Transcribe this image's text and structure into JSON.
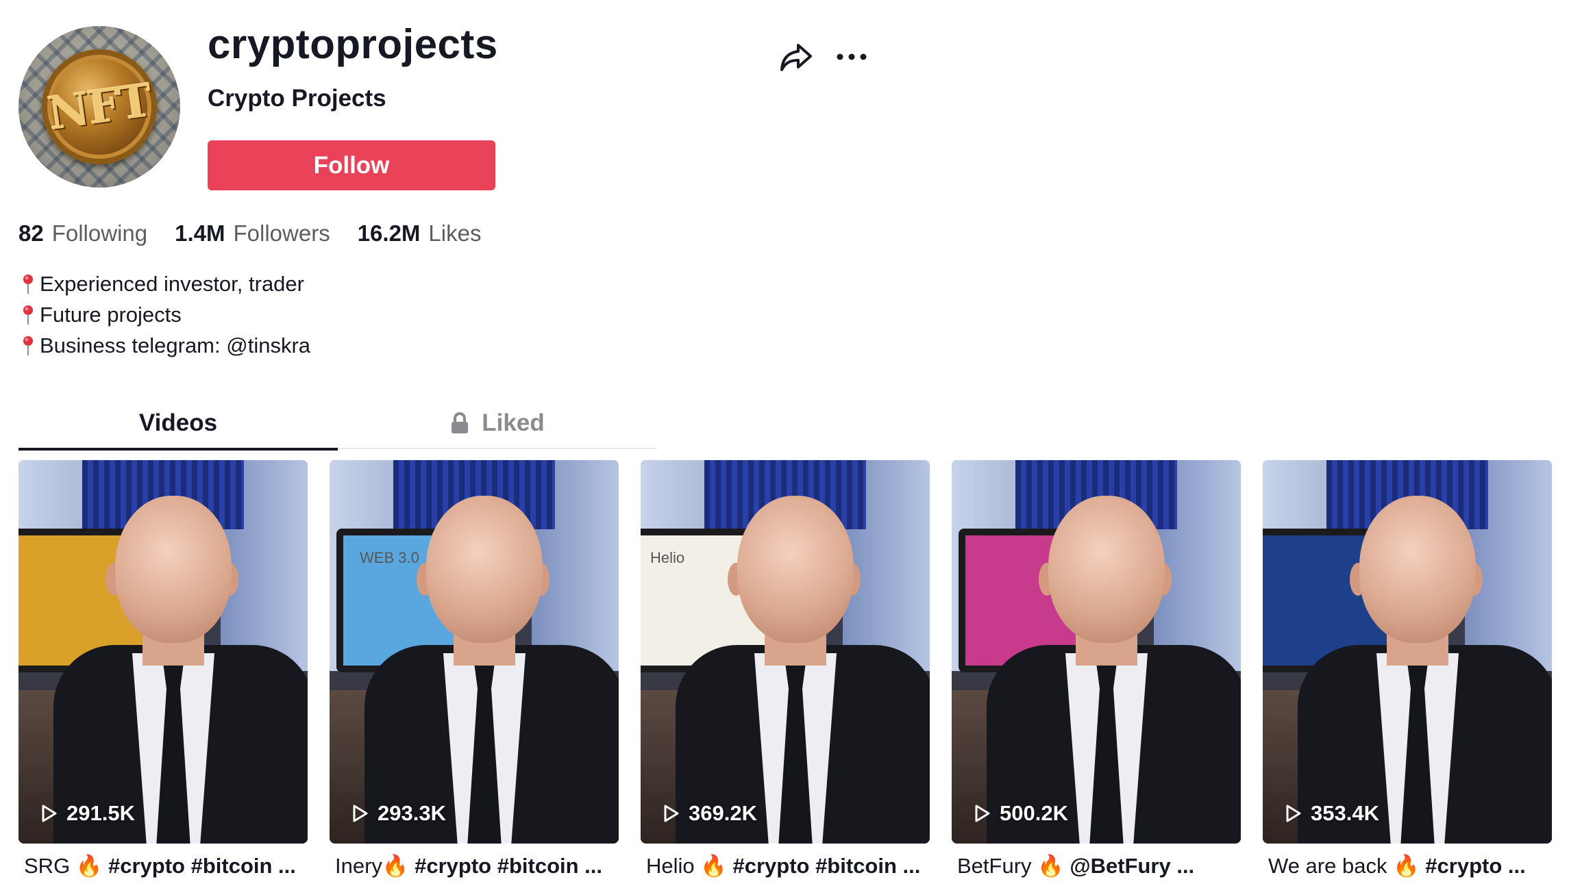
{
  "profile": {
    "avatar_text": "NFT",
    "username": "cryptoprojects",
    "nickname": "Crypto Projects",
    "follow_label": "Follow",
    "share_icon": "share-icon",
    "more_icon": "more-icon"
  },
  "stats": [
    {
      "value": "82",
      "label": "Following"
    },
    {
      "value": "1.4M",
      "label": "Followers"
    },
    {
      "value": "16.2M",
      "label": "Likes"
    }
  ],
  "bio": [
    "Experienced investor, trader",
    "Future projects",
    "Business telegram: @tinskra"
  ],
  "tabs": [
    {
      "label": "Videos",
      "active": true
    },
    {
      "label": "Liked",
      "active": false,
      "icon": "lock-icon"
    }
  ],
  "videos": [
    {
      "views": "291.5K",
      "caption_plain": "SRG 🔥 ",
      "caption_bold": "#crypto #bitcoin ...",
      "screen_color": "#d9a12a",
      "screen_label": ""
    },
    {
      "views": "293.3K",
      "caption_plain": "Inery🔥 ",
      "caption_bold": "#crypto #bitcoin ...",
      "screen_color": "#5aa7e0",
      "screen_label": "WEB 3.0"
    },
    {
      "views": "369.2K",
      "caption_plain": "Helio 🔥 ",
      "caption_bold": "#crypto #bitcoin ...",
      "screen_color": "#f2efe6",
      "screen_label": "Helio"
    },
    {
      "views": "500.2K",
      "caption_plain": "BetFury 🔥 ",
      "caption_bold": "@BetFury ...",
      "screen_color": "#c83a8c",
      "screen_label": ""
    },
    {
      "views": "353.4K",
      "caption_plain": "We are back 🔥 ",
      "caption_bold": "#crypto ...",
      "screen_color": "#1e3f8a",
      "screen_label": ""
    }
  ],
  "colors": {
    "follow_bg": "#ea4359",
    "text_primary": "#161823",
    "text_secondary": "#5c5d63",
    "tab_inactive": "#8a8b91"
  }
}
